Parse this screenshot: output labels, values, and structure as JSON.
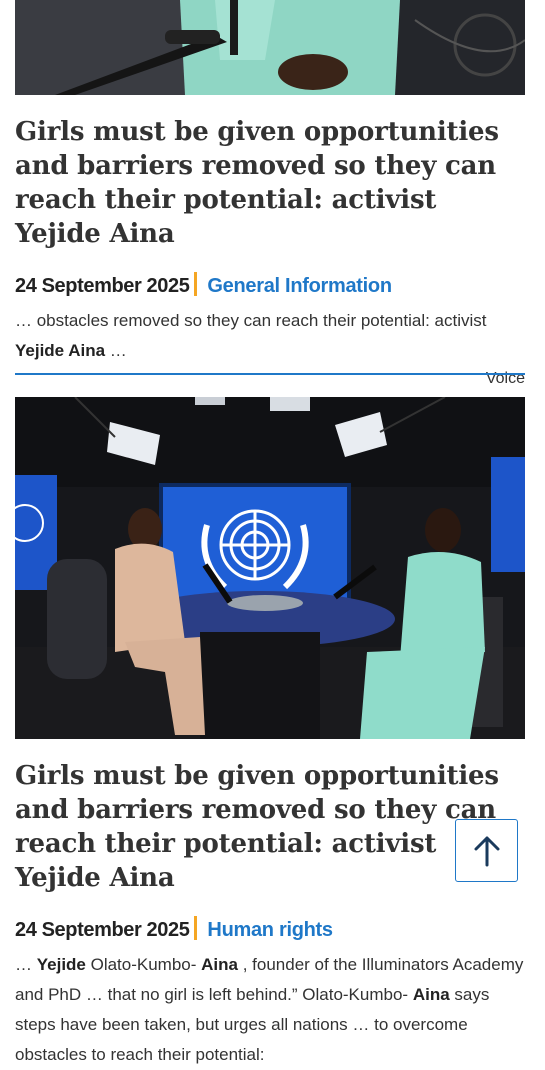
{
  "articles": [
    {
      "title": "Girls must be given opportunities and barriers removed so they can reach their potential: activist Yejide Aina",
      "date": "24 September 2025",
      "category": "General Information",
      "snippet_parts": [
        "… obstacles removed so they can reach their potential: activist ",
        "Yejide Aina",
        " …"
      ],
      "source": "Voice"
    },
    {
      "title": "Girls must be given opportunities and barriers removed so they can reach their potential: activist Yejide Aina",
      "date": "24 September 2025",
      "category": "Human rights",
      "snippet_parts": [
        "… ",
        "Yejide",
        " Olato-Kumbo- ",
        "Aina",
        " , founder of the Illuminators Academy and PhD … that no girl is left behind.” Olato-Kumbo- ",
        "Aina",
        " says steps have been taken, but urges all nations … to overcome obstacles to reach their potential:"
      ]
    }
  ],
  "scroll_to_top": {
    "icon": "arrow-up-icon"
  },
  "colors": {
    "accent": "#1f78c8",
    "separator": "#f5a623",
    "text": "#333333"
  }
}
